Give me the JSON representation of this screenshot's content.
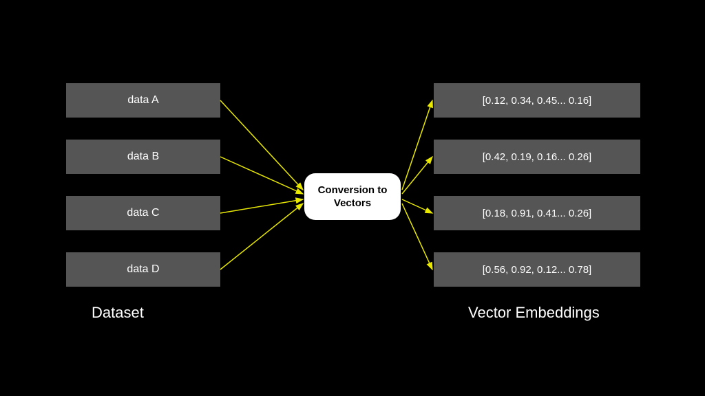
{
  "dataset": {
    "label": "Dataset",
    "items": [
      "data A",
      "data B",
      "data C",
      "data D"
    ]
  },
  "center": {
    "label": "Conversion to Vectors"
  },
  "embeddings": {
    "label": "Vector Embeddings",
    "items": [
      "[0.12, 0.34, 0.45... 0.16]",
      "[0.42, 0.19, 0.16... 0.26]",
      "[0.18, 0.91, 0.41... 0.26]",
      "[0.56, 0.92, 0.12... 0.78]"
    ]
  }
}
